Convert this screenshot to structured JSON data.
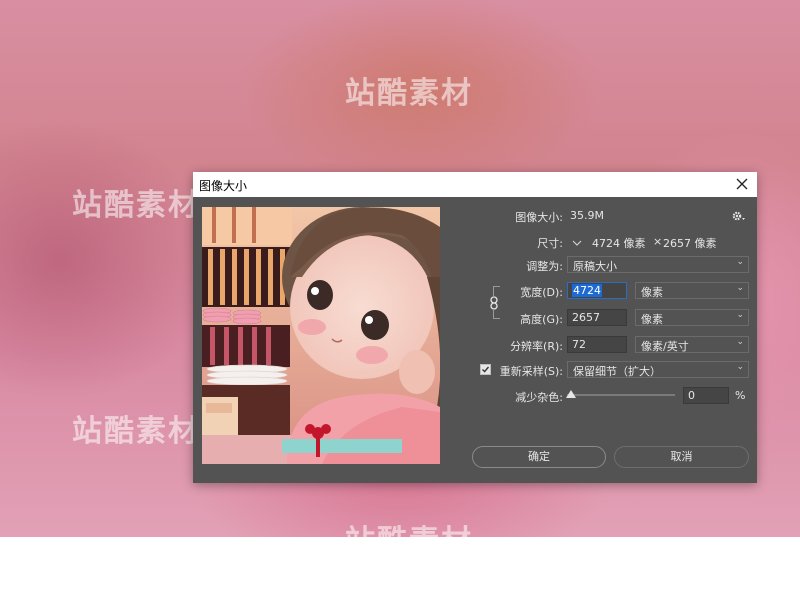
{
  "watermark": "站酷素材",
  "dialog": {
    "title": "图像大小",
    "image_size_label": "图像大小:",
    "image_size_value": "35.9M",
    "dimensions_label": "尺寸:",
    "dimensions_width": "4724 像素",
    "dimensions_sep": "×",
    "dimensions_height": "2657 像素",
    "fit_to_label": "调整为:",
    "fit_to_value": "原稿大小",
    "width_label": "宽度(D):",
    "width_value": "4724",
    "width_unit": "像素",
    "height_label": "高度(G):",
    "height_value": "2657",
    "height_unit": "像素",
    "resolution_label": "分辨率(R):",
    "resolution_value": "72",
    "resolution_unit": "像素/英寸",
    "resample_label": "重新采样(S):",
    "resample_checked": true,
    "resample_value": "保留细节（扩大）",
    "noise_label": "减少杂色:",
    "noise_value": "0",
    "noise_unit": "%",
    "noise_level": 0,
    "ok_label": "确定",
    "cancel_label": "取消"
  },
  "icons": {
    "close": "close-icon",
    "settings": "gear-icon",
    "link": "chain-link-icon",
    "dropdown": "chevron-down-icon",
    "check": "checkmark-icon"
  },
  "colors": {
    "dialog_bg": "#535353",
    "selection": "#1e6ad4"
  }
}
